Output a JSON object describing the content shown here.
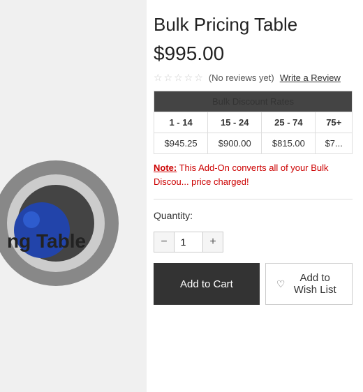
{
  "product": {
    "title": "Bulk Pricing Table",
    "price": "$995.00",
    "image_label": "ng Table"
  },
  "reviews": {
    "text": "(No reviews yet)",
    "write_label": "Write a Review",
    "stars": [
      "☆",
      "☆",
      "☆",
      "☆",
      "☆"
    ]
  },
  "bulk_table": {
    "header": "Bulk Discount Rates",
    "columns": [
      "1 - 14",
      "15 - 24",
      "25 - 74",
      "75+"
    ],
    "prices": [
      "$945.25",
      "$900.00",
      "$815.00",
      "$7..."
    ]
  },
  "note": {
    "label": "Note:",
    "body": " This Add-On converts all of your Bulk Discou... price charged!"
  },
  "quantity": {
    "label": "Quantity:",
    "value": "1"
  },
  "buttons": {
    "add_to_cart": "Add to Cart",
    "add_to_wish_list": "Add to Wish List"
  }
}
